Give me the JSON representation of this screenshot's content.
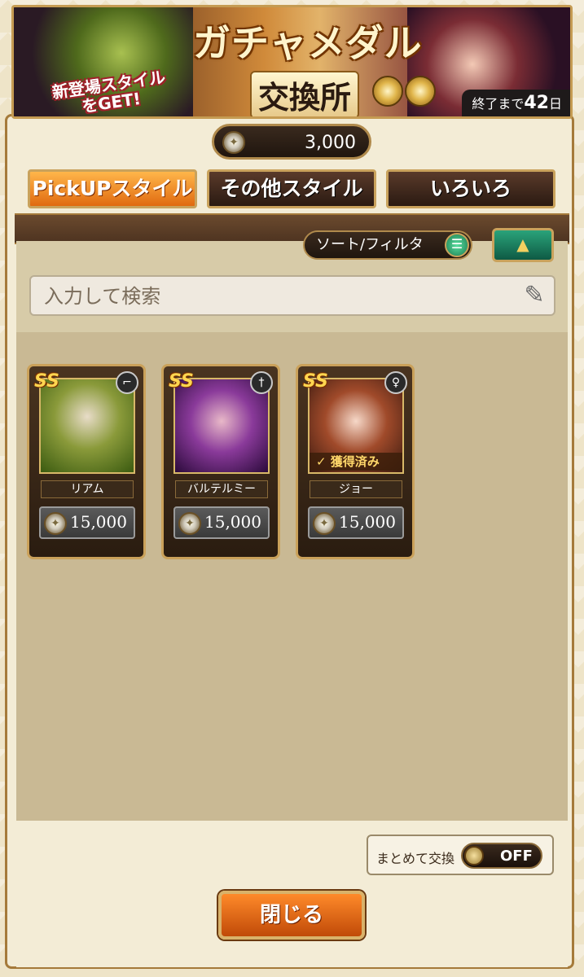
{
  "banner": {
    "title": "ガチャメダル",
    "subtitle": "交換所",
    "tag_line1": "新登場スタイル",
    "tag_line2": "をGET!",
    "end_prefix": "終了まで",
    "end_days": "42",
    "end_suffix": "日"
  },
  "currency": {
    "amount": "3,000",
    "icon": "medal-coin-icon"
  },
  "tabs": [
    {
      "label": "PickUPスタイル",
      "active": true
    },
    {
      "label": "その他スタイル",
      "active": false
    },
    {
      "label": "いろいろ",
      "active": false
    }
  ],
  "sort": {
    "label": "ソート/フィルタ",
    "icon": "menu-icon"
  },
  "search": {
    "placeholder": "入力して検索",
    "value": ""
  },
  "cards": [
    {
      "name": "リアム",
      "price": "15,000",
      "rank": "SS",
      "weapon_icon": "gun-icon",
      "owned_label": ""
    },
    {
      "name": "バルテルミー",
      "price": "15,000",
      "rank": "SS",
      "weapon_icon": "sword-icon",
      "owned_label": ""
    },
    {
      "name": "ジョー",
      "price": "15,000",
      "rank": "SS",
      "weapon_icon": "staff-icon",
      "owned_label": "獲得済み"
    }
  ],
  "bulk": {
    "label": "まとめて交換",
    "state": "OFF"
  },
  "close_button": "閉じる",
  "colors": {
    "accent": "#e06a10",
    "frame": "#caa15a",
    "green": "#1a7a50"
  }
}
